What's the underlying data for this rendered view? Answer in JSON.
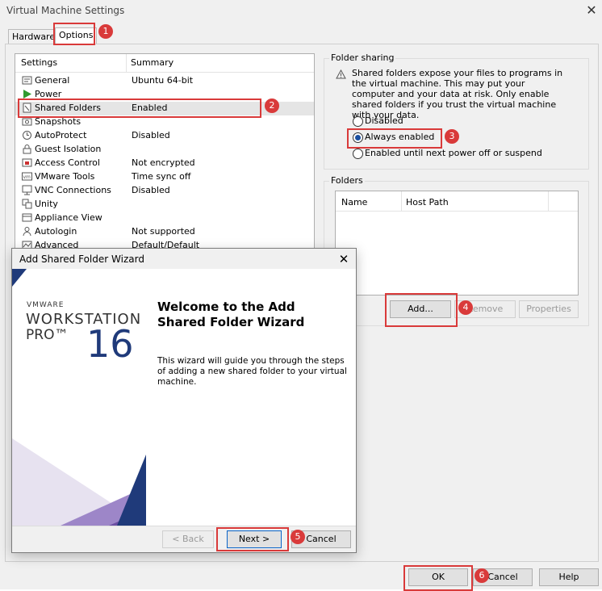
{
  "window": {
    "title": "Virtual Machine Settings"
  },
  "tabs": [
    {
      "label": "Hardware"
    },
    {
      "label": "Options"
    }
  ],
  "settings_list": {
    "headers": [
      "Settings",
      "Summary"
    ],
    "rows": [
      {
        "name": "General",
        "summary": "Ubuntu 64-bit",
        "icon": "general-icon"
      },
      {
        "name": "Power",
        "summary": "",
        "icon": "power-play-icon"
      },
      {
        "name": "Shared Folders",
        "summary": "Enabled",
        "icon": "shared-folders-icon"
      },
      {
        "name": "Snapshots",
        "summary": "",
        "icon": "snapshots-icon"
      },
      {
        "name": "AutoProtect",
        "summary": "Disabled",
        "icon": "autoprotect-icon"
      },
      {
        "name": "Guest Isolation",
        "summary": "",
        "icon": "guest-isolation-icon"
      },
      {
        "name": "Access Control",
        "summary": "Not encrypted",
        "icon": "access-control-icon"
      },
      {
        "name": "VMware Tools",
        "summary": "Time sync off",
        "icon": "vmware-tools-icon"
      },
      {
        "name": "VNC Connections",
        "summary": "Disabled",
        "icon": "vnc-icon"
      },
      {
        "name": "Unity",
        "summary": "",
        "icon": "unity-icon"
      },
      {
        "name": "Appliance View",
        "summary": "",
        "icon": "appliance-view-icon"
      },
      {
        "name": "Autologin",
        "summary": "Not supported",
        "icon": "autologin-icon"
      },
      {
        "name": "Advanced",
        "summary": "Default/Default",
        "icon": "advanced-icon"
      }
    ]
  },
  "folder_sharing": {
    "label": "Folder sharing",
    "warning": "Shared folders expose your files to programs in the virtual machine. This may put your computer and your data at risk. Only enable shared folders if you trust the virtual machine with your data.",
    "options": [
      "Disabled",
      "Always enabled",
      "Enabled until next power off or suspend"
    ],
    "selected": "Always enabled"
  },
  "folders": {
    "label": "Folders",
    "columns": [
      "Name",
      "Host Path"
    ],
    "buttons": {
      "add": "Add...",
      "remove": "Remove",
      "properties": "Properties"
    }
  },
  "wizard": {
    "title": "Add Shared Folder Wizard",
    "logo": {
      "line1": "VMWARE",
      "line2": "WORKSTATION",
      "line3": "PRO™",
      "version": "16"
    },
    "heading": "Welcome to the Add Shared Folder Wizard",
    "body": "This wizard will guide you through the steps of adding a new shared folder to your virtual machine.",
    "buttons": {
      "back": "< Back",
      "next": "Next >",
      "cancel": "Cancel"
    }
  },
  "footer_buttons": {
    "ok": "OK",
    "cancel": "Cancel",
    "help": "Help"
  },
  "callouts": [
    "1",
    "2",
    "3",
    "4",
    "5",
    "6"
  ],
  "colors": {
    "callout": "#d93a3a",
    "radio_dot": "#1a4fa0",
    "wizard_navy": "#1f3a7a",
    "wizard_purple": "#6b4fa3"
  }
}
